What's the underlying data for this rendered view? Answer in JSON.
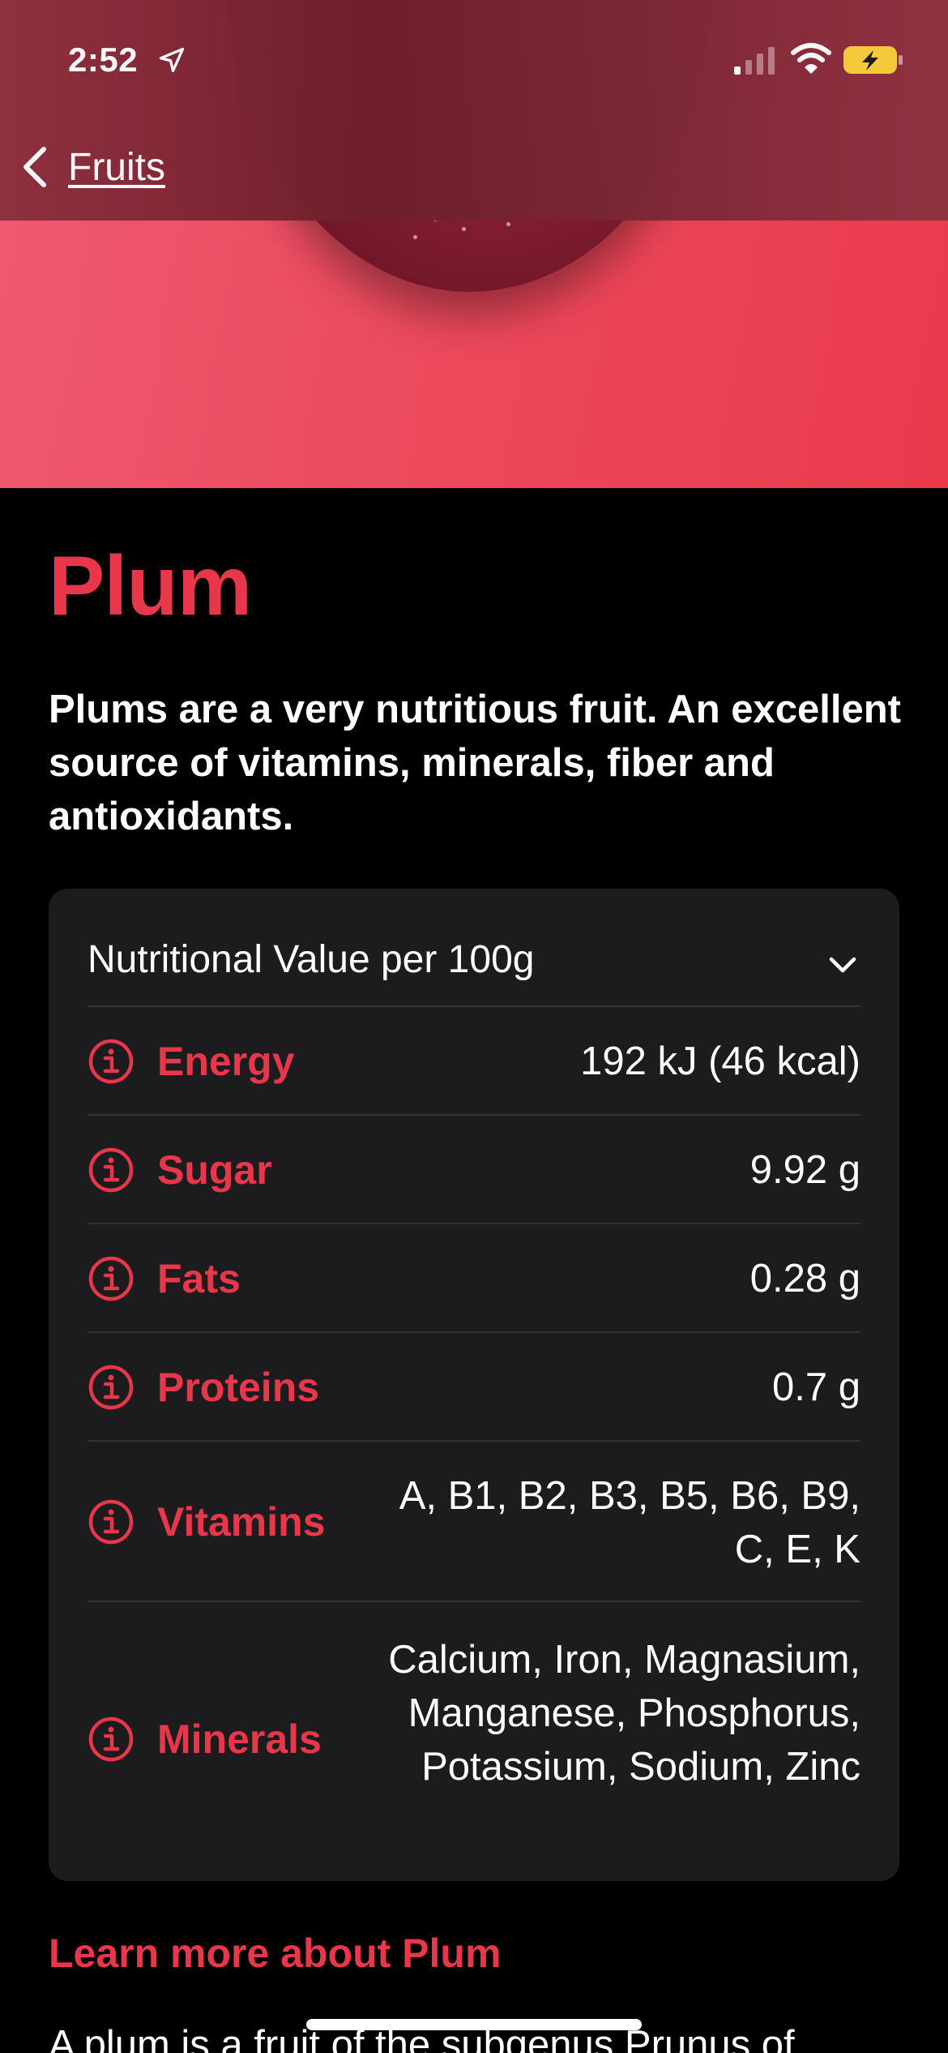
{
  "status_bar": {
    "time": "2:52"
  },
  "nav": {
    "back_label": "Fruits"
  },
  "fruit": {
    "name": "Plum",
    "description": "Plums are a very nutritious fruit. An excellent source of vitamins, minerals, fiber and antioxidants."
  },
  "nutrition": {
    "header": "Nutritional Value per 100g",
    "rows": [
      {
        "label": "Energy",
        "value": "192 kJ (46 kcal)"
      },
      {
        "label": "Sugar",
        "value": "9.92 g"
      },
      {
        "label": "Fats",
        "value": "0.28 g"
      },
      {
        "label": "Proteins",
        "value": "0.7 g"
      },
      {
        "label": "Vitamins",
        "value": "A, B1, B2, B3, B5, B6, B9, C, E, K"
      },
      {
        "label": "Minerals",
        "value": "Calcium, Iron, Magnasium, Manganese, Phosphorus, Potassium, Sodium, Zinc"
      }
    ]
  },
  "learn_more": {
    "label": "Learn more about Plum",
    "text_start": "A plum is a fruit of the subgenus Prunus of"
  },
  "colors": {
    "accent": "#e8364b",
    "card": "#1c1c1e",
    "hero": "#ec4a5e",
    "navbar": "#7a2533"
  }
}
